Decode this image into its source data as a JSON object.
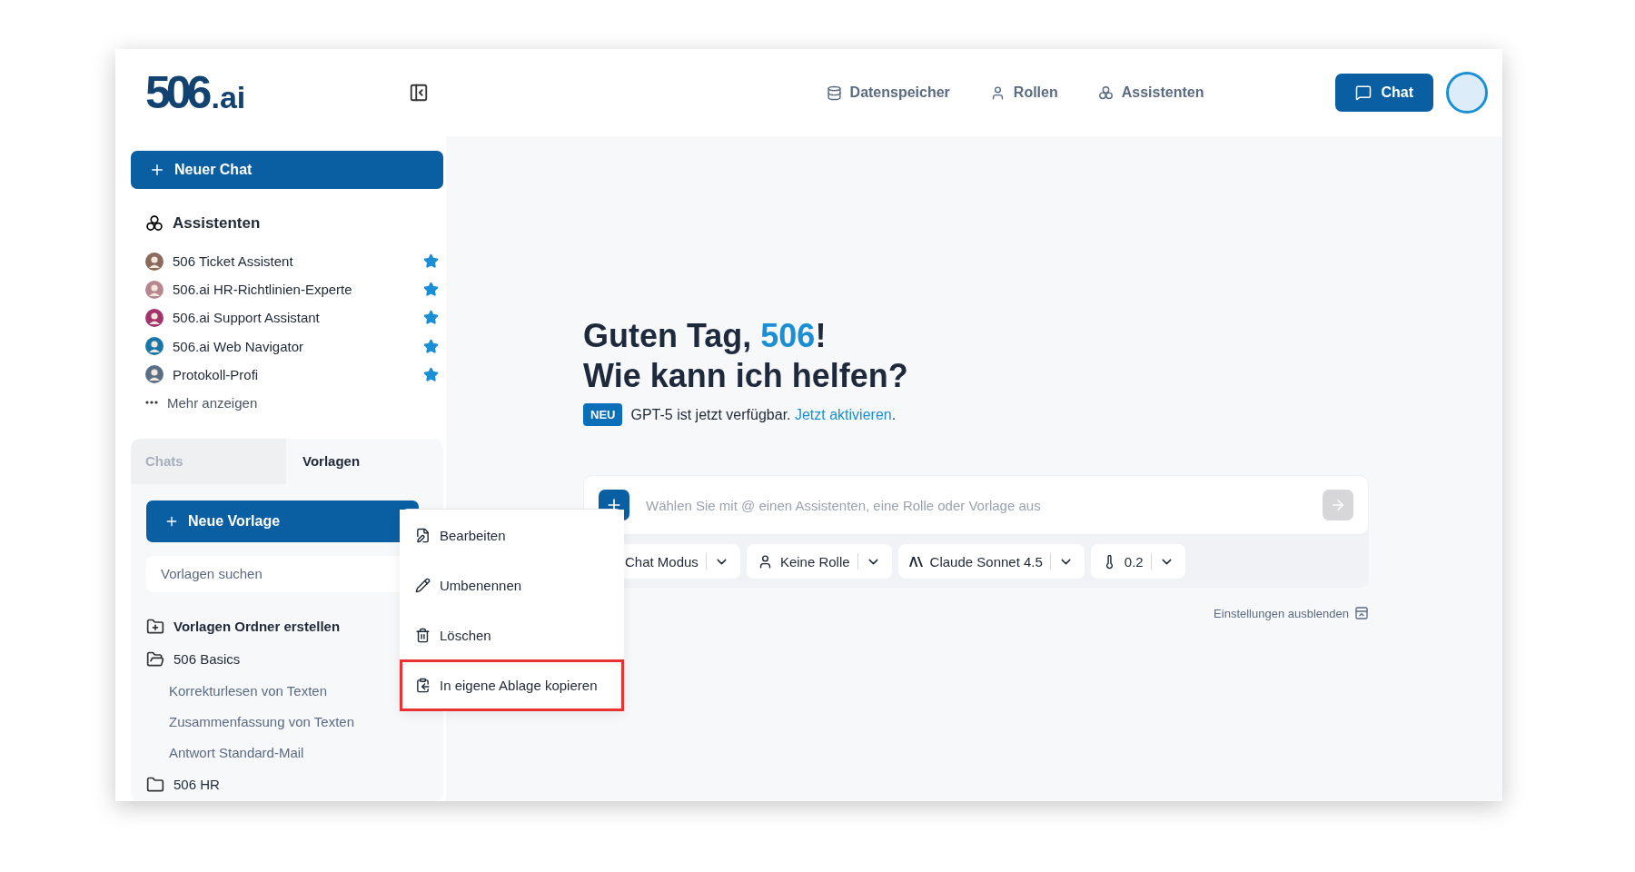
{
  "brand": {
    "logo": "506",
    "suffix": ".ai"
  },
  "nav": [
    {
      "kind": "storage",
      "label": "Datenspeicher"
    },
    {
      "kind": "roles",
      "label": "Rollen"
    },
    {
      "kind": "assistants",
      "label": "Assistenten"
    }
  ],
  "chat_button": "Chat",
  "sidebar": {
    "new_chat": "Neuer Chat",
    "assistants_title": "Assistenten",
    "assistants": [
      {
        "name": "506 Ticket Assistent",
        "favorite": true,
        "color": "#8a6a5a"
      },
      {
        "name": "506.ai HR-Richtlinien-Experte",
        "favorite": true,
        "color": "#b8868f"
      },
      {
        "name": "506.ai Support Assistant",
        "favorite": true,
        "color": "#a3336b"
      },
      {
        "name": "506.ai Web Navigator",
        "favorite": true,
        "color": "#1677a8"
      },
      {
        "name": "Protokoll-Profi",
        "favorite": true,
        "color": "#5b6f86"
      }
    ],
    "more": "Mehr anzeigen",
    "tabs": [
      {
        "label": "Chats",
        "selected": false
      },
      {
        "label": "Vorlagen",
        "selected": true
      }
    ],
    "new_template": "Neue Vorlage",
    "search": {
      "placeholder": "Vorlagen suchen"
    },
    "create_folder": "Vorlagen Ordner erstellen",
    "folders": [
      {
        "name": "506 Basics",
        "expanded": true,
        "children": [
          {
            "name": "Korrekturlesen von Texten"
          },
          {
            "name": "Zusammenfassung von Texten"
          },
          {
            "name": "Antwort Standard-Mail"
          }
        ]
      },
      {
        "name": "506 HR",
        "expanded": false
      }
    ]
  },
  "context_menu": {
    "items": [
      {
        "kind": "edit",
        "label": "Bearbeiten",
        "highlighted": false
      },
      {
        "kind": "rename",
        "label": "Umbenennen",
        "highlighted": false
      },
      {
        "kind": "delete",
        "label": "Löschen",
        "highlighted": false
      },
      {
        "kind": "copy",
        "label": "In eigene Ablage kopieren",
        "highlighted": true
      }
    ]
  },
  "main": {
    "greeting": [
      "Guten Tag, ",
      "506",
      "!"
    ],
    "subtitle": "Wie kann ich helfen?",
    "badge": "NEU",
    "notice": "GPT-5 ist jetzt verfügbar. ",
    "notice_link": "Jetzt aktivieren",
    "notice_end": ".",
    "input": {
      "placeholder": "Wählen Sie mit @ einen Assistenten, eine Rolle oder Vorlage aus",
      "send_disabled": true
    },
    "settings": [
      {
        "kind": "mode",
        "label": "Chat Modus"
      },
      {
        "kind": "role",
        "label": "Keine Rolle"
      },
      {
        "kind": "model",
        "label": "Claude Sonnet 4.5"
      },
      {
        "kind": "temperature",
        "label": "0.2"
      }
    ],
    "hide_settings": "Einstellungen ausblenden"
  }
}
